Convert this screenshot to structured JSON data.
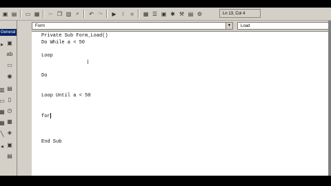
{
  "toolbar": {
    "icons": [
      "vb-icon",
      "menu-editor-icon",
      "open-icon",
      "save-icon",
      "cut-icon",
      "copy-icon",
      "paste-icon",
      "find-icon",
      "undo-icon",
      "redo-icon",
      "run-icon",
      "pause-icon",
      "stop-icon",
      "project-explorer-icon",
      "properties-icon",
      "form-layout-icon",
      "object-browser-icon",
      "toolbox-icon",
      "data-view-icon",
      "component-manager-icon"
    ],
    "position": "Ln 13, Col 4"
  },
  "toolbox": {
    "title": "General"
  },
  "editor": {
    "object_combo": "Form",
    "procedure_combo": "Load",
    "lines": [
      "Private Sub Form_Load()",
      "Do While a < 50",
      "Loop",
      "Do",
      "Loop Until a < 50",
      "for",
      "End Sub"
    ]
  }
}
